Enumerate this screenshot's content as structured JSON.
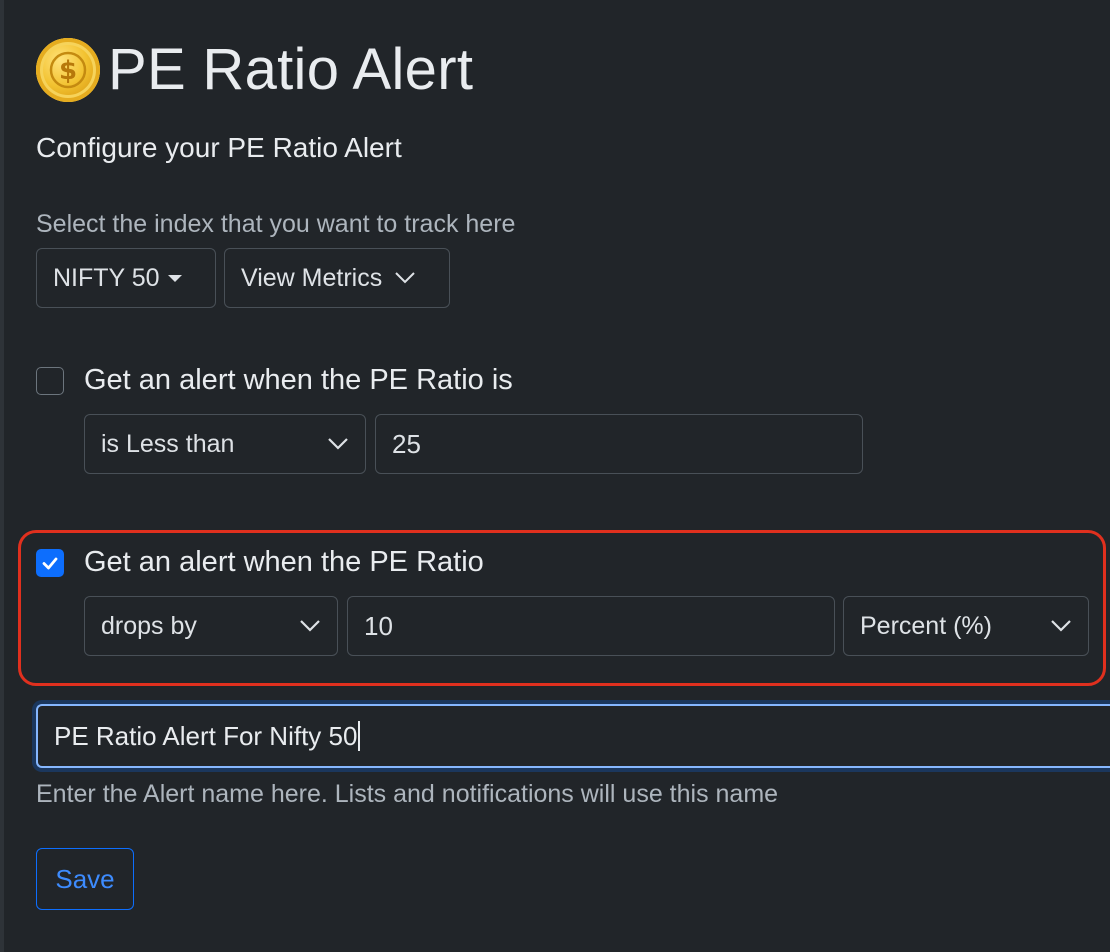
{
  "header": {
    "title": "PE Ratio Alert",
    "icon": "gold-coin-dollar-icon"
  },
  "subtitle": "Configure your PE Ratio Alert",
  "index_select": {
    "label": "Select the index that you want to track here",
    "selected": "NIFTY 50",
    "metrics_button": "View Metrics"
  },
  "condition1": {
    "checked": false,
    "label": "Get an alert when the PE Ratio is",
    "comparator": "is Less than",
    "value": "25"
  },
  "condition2": {
    "checked": true,
    "label": "Get an alert when the PE Ratio",
    "direction": "drops by",
    "value": "10",
    "unit": "Percent (%)"
  },
  "alert_name": {
    "value": "PE Ratio Alert For Nifty 50",
    "help": "Enter the Alert name here. Lists and notifications will use this name"
  },
  "save_label": "Save",
  "colors": {
    "background": "#212529",
    "accent": "#0d6efd",
    "highlight": "#e0301e"
  }
}
